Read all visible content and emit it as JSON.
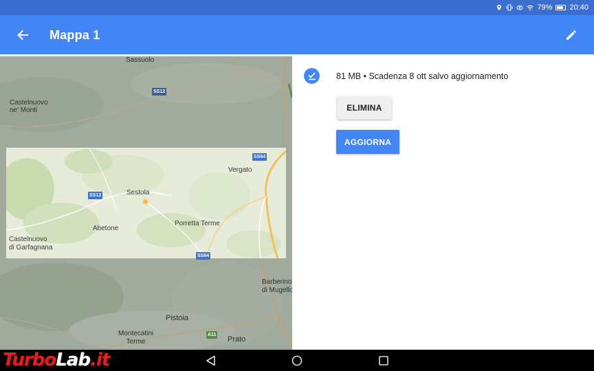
{
  "status_bar": {
    "battery": "79%",
    "time": "20:40"
  },
  "app_bar": {
    "title": "Mappa 1",
    "back_icon": "arrow-back-icon",
    "edit_icon": "pencil-icon"
  },
  "map": {
    "places": {
      "sassuolo": "Sassuolo",
      "castelnuovo_monti": "Castelnuovo\nne' Monti",
      "vergato": "Vergato",
      "sestola": "Sestola",
      "abetone": "Abetone",
      "porretta": "Porretta Terme",
      "castelnuovo_garfagnana": "Castelnuovo\ndi Garfagnana",
      "barberino": "Barberino\ndi Mugello",
      "pistoia": "Pistoia",
      "montecatini": "Montecatini\nTerme",
      "prato": "Prato"
    },
    "roads": {
      "ss12_top": "SS12",
      "ss64_top": "SS64",
      "ss12_mid": "SS12",
      "ss64_bottom": "SS64",
      "a11": "A11"
    }
  },
  "download": {
    "info": "81 MB • Scadenza 8 ott salvo aggiornamento",
    "delete_label": "ELIMINA",
    "update_label": "AGGIORNA"
  },
  "watermark": {
    "part1": "Turbo",
    "part2": "Lab",
    "part3": ".it"
  },
  "colors": {
    "status_bar": "#3a6fd0",
    "app_bar": "#4285f4",
    "accent": "#4285f4"
  }
}
